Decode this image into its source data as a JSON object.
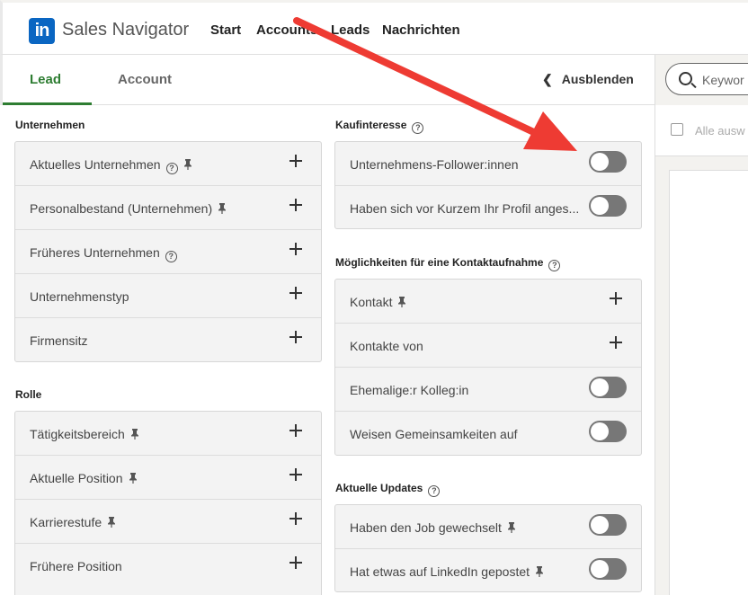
{
  "header": {
    "logo_text": "in",
    "brand": "Sales Navigator",
    "nav": [
      "Start",
      "Accounts",
      "Leads",
      "Nachrichten"
    ]
  },
  "tabs": {
    "lead": "Lead",
    "account": "Account",
    "hide": "Ausblenden"
  },
  "left": {
    "company_title": "Unternehmen",
    "company_items": [
      {
        "label": "Aktuelles Unternehmen"
      },
      {
        "label": "Personalbestand (Unternehmen)"
      },
      {
        "label": "Früheres Unternehmen"
      },
      {
        "label": "Unternehmenstyp"
      },
      {
        "label": "Firmensitz"
      }
    ],
    "role_title": "Rolle",
    "role_items": [
      {
        "label": "Tätigkeitsbereich"
      },
      {
        "label": "Aktuelle Position"
      },
      {
        "label": "Karrierestufe"
      },
      {
        "label": "Frühere Position"
      }
    ]
  },
  "middle": {
    "interest_title": "Kaufinteresse",
    "interest_items": [
      {
        "label": "Unternehmens-Follower:innen"
      },
      {
        "label": "Haben sich vor Kurzem Ihr Profil anges..."
      }
    ],
    "contact_title": "Möglichkeiten für eine Kontaktaufnahme",
    "contact_items": [
      {
        "label": "Kontakt"
      },
      {
        "label": "Kontakte von"
      },
      {
        "label": "Ehemalige:r Kolleg:in"
      },
      {
        "label": "Weisen Gemeinsamkeiten auf"
      }
    ],
    "updates_title": "Aktuelle Updates",
    "updates_items": [
      {
        "label": "Haben den Job gewechselt"
      },
      {
        "label": "Hat etwas auf LinkedIn gepostet"
      }
    ]
  },
  "right": {
    "search_placeholder": "Keywor",
    "select_all": "Alle ausw"
  },
  "colors": {
    "brand": "#0a66c2",
    "active_tab": "#2e7d32",
    "annotation_arrow": "#ee3b33"
  }
}
